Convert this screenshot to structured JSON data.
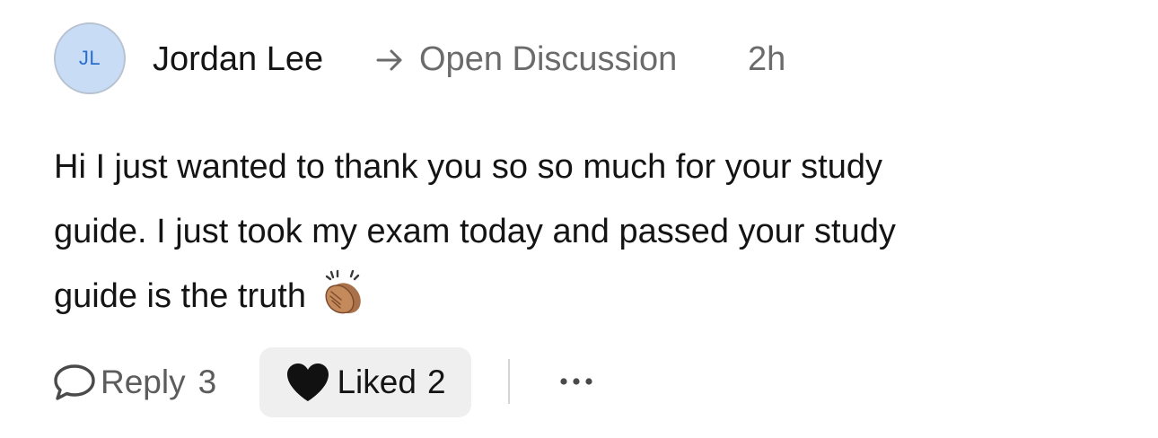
{
  "post": {
    "author": {
      "initials": "JL",
      "name": "Jordan Lee"
    },
    "destination": "Open Discussion",
    "time": "2h",
    "body_lines": [
      "Hi I just wanted to thank you so so much for your study",
      "guide. I just took my exam today and passed your study",
      "guide is the truth"
    ],
    "emoji": "clapping-hands"
  },
  "actions": {
    "reply_label": "Reply",
    "reply_count": "3",
    "like_label": "Liked",
    "like_count": "2",
    "liked": true
  },
  "icons": {
    "arrow": "arrow-right-icon",
    "reply": "speech-bubble-icon",
    "like": "heart-icon",
    "more": "more-options-icon",
    "emoji": "clapping-hands-icon"
  },
  "colors": {
    "avatar_bg": "#c9dcf6",
    "avatar_text": "#2a6fcf",
    "muted_text": "#6b6b6b",
    "like_bg": "#efefef"
  }
}
